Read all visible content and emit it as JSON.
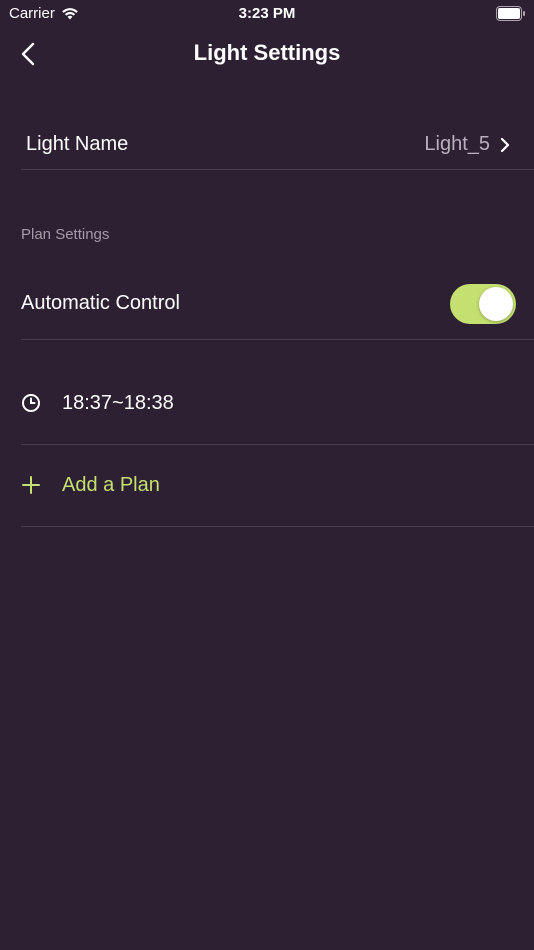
{
  "status_bar": {
    "carrier": "Carrier",
    "time": "3:23 PM"
  },
  "nav": {
    "title": "Light Settings"
  },
  "light_name": {
    "label": "Light Name",
    "value": "Light_5"
  },
  "plan_settings": {
    "header": "Plan Settings",
    "automatic_control": {
      "label": "Automatic Control",
      "enabled": true
    },
    "plans": [
      {
        "time": "18:37~18:38",
        "icon": "clock-icon"
      }
    ],
    "add_plan_label": "Add a Plan"
  },
  "colors": {
    "background": "#2d2032",
    "accent": "#c4e070",
    "divider": "#4a3d4f",
    "secondary_text": "#a49ba8"
  }
}
